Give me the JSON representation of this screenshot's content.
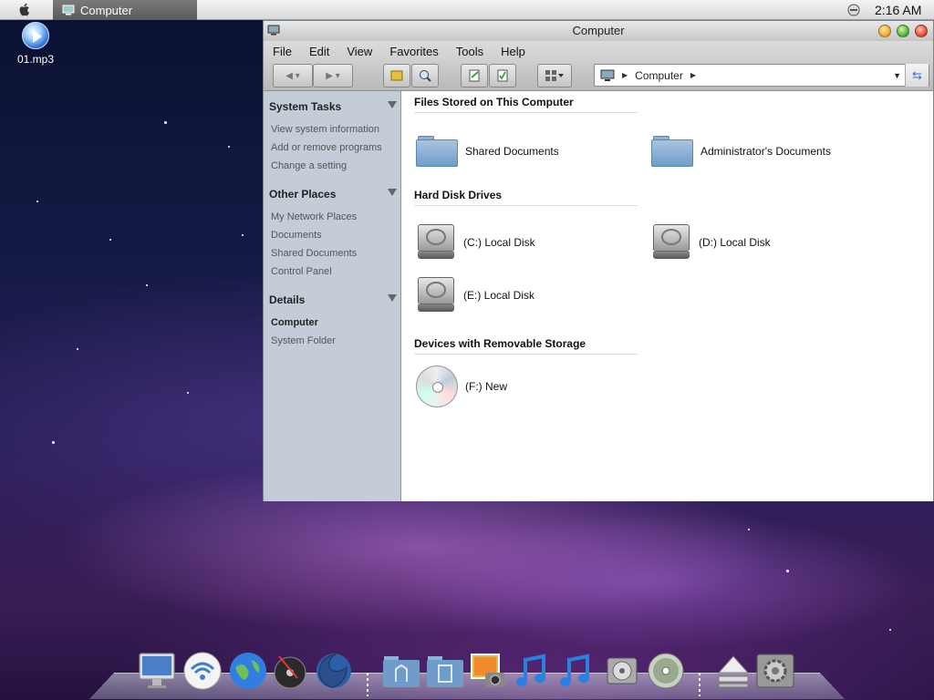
{
  "menubar": {
    "active_task": "Computer",
    "clock": "2:16 AM"
  },
  "desktop": {
    "icon_label": "01.mp3"
  },
  "window": {
    "title": "Computer",
    "menus": [
      "File",
      "Edit",
      "View",
      "Favorites",
      "Tools",
      "Help"
    ],
    "address": {
      "value": "Computer"
    },
    "sidebar": {
      "system_tasks": {
        "title": "System Tasks",
        "items": [
          "View system information",
          "Add or remove programs",
          "Change a setting"
        ]
      },
      "other_places": {
        "title": "Other Places",
        "items": [
          "My Network Places",
          "Documents",
          "Shared Documents",
          "Control Panel"
        ]
      },
      "details": {
        "title": "Details",
        "name": "Computer",
        "type": "System Folder"
      }
    },
    "groups": {
      "files": {
        "title": "Files Stored on This Computer",
        "items": [
          "Shared Documents",
          "Administrator's Documents"
        ]
      },
      "drives": {
        "title": "Hard Disk Drives",
        "items": [
          "(C:) Local Disk",
          "(D:) Local Disk",
          "(E:) Local Disk"
        ]
      },
      "removable": {
        "title": "Devices with Removable Storage",
        "items": [
          "(F:) New"
        ]
      }
    }
  },
  "dock": {
    "items": [
      "monitor-icon",
      "wifi-icon",
      "globe-icon",
      "dvd-player-icon",
      "firefox-icon",
      "applications-folder-icon",
      "documents-folder-icon",
      "photo-icon",
      "music-note-icon",
      "music-note-icon",
      "hard-drive-icon",
      "cd-icon",
      "eject-icon",
      "system-preferences-icon"
    ]
  },
  "colors": {
    "sidebar_bg": "#c3ccd7",
    "window_chrome": "#cfcfcf",
    "folder_blue": "#6f9cc8"
  }
}
